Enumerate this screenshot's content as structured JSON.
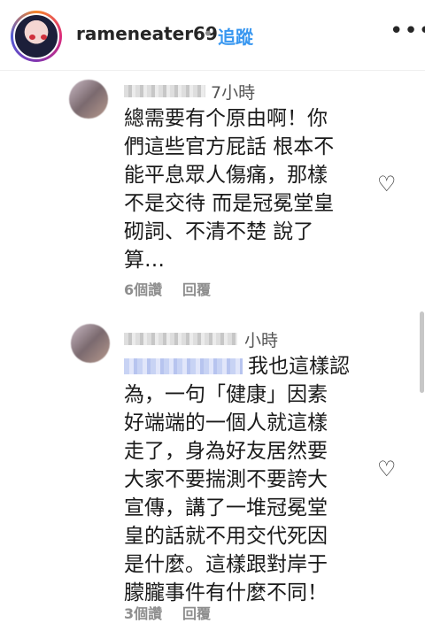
{
  "header": {
    "username": "rameneater69",
    "separator": "•",
    "follow_label": "追蹤",
    "more_icon": "more-horizontal-icon"
  },
  "comments": [
    {
      "time": "7小時",
      "text": "總需要有个原由啊！你\n們這些官方屁話 根本不\n能平息眾人傷痛，那樣\n不是交待 而是冠冕堂皇\n砌詞、不清不楚 說了\n算…",
      "likes": "6個讚",
      "reply": "回覆"
    },
    {
      "time": "小時",
      "text_first_line": "我也這樣認",
      "text": "為，一句「健康」因素\n好端端的一個人就這樣\n走了，身為好友居然要\n大家不要揣測不要誇大\n宣傳，講了一堆冠冕堂\n皇的話就不用交代死因\n是什麼。這樣跟對岸于\n朦朧事件有什麼不同！",
      "likes": "3個讚",
      "reply": "回覆"
    }
  ]
}
